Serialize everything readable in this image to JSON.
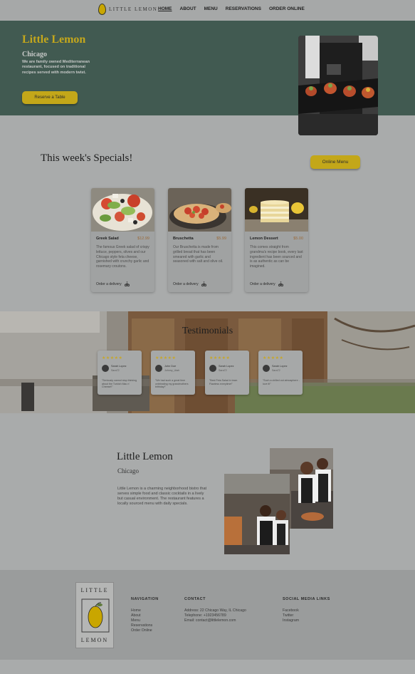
{
  "nav": {
    "logo_text": "LITTLE LEMON",
    "links": [
      "HOME",
      "ABOUT",
      "MENU",
      "RESERVATIONS",
      "ORDER ONLINE"
    ]
  },
  "hero": {
    "title": "Little Lemon",
    "city": "Chicago",
    "description": "We are family owned Mediterranean restaurant, focused on traditional recipes served with modern twist.",
    "button": "Reserve a Table"
  },
  "specials": {
    "title": "This week's Specials!",
    "button": "Online Menu",
    "order_label": "Order a delivery",
    "cards": [
      {
        "name": "Greek Salad",
        "price": "$12.99",
        "description": "The famous Greek salad of crispy lettuce, peppers, olives and our Chicago style feta cheese, garnished with crunchy garlic and rosemary croutons."
      },
      {
        "name": "Bruschetta",
        "price": "$5.99",
        "description": "Our Bruschetta is made from grilled bread that has been smeared with garlic and seasoned with salt and olive oil."
      },
      {
        "name": "Lemon Dessert",
        "price": "$5.00",
        "description": "This comes straight from grandma's recipe book, every last ingredient has been sourced and is as authentic as can be imagined."
      }
    ]
  },
  "testimonials": {
    "title": "Testimonials",
    "stars": "★★★★★",
    "items": [
      {
        "name": "Sarah Lopez",
        "sub": "Sara72",
        "quote": "\"Seriously cannot stop thinking about the Turkish Mac n' Cheese!!\""
      },
      {
        "name": "John Doe",
        "sub": "Johnny_Utah",
        "quote": "\"We had such a great time celebrating my grandmothers bitthday!\""
      },
      {
        "name": "Sarah Lopez",
        "sub": "Sara72",
        "quote": "\"Best Feta Salad in town. Flawless everytime!\""
      },
      {
        "name": "Sarah Lopez",
        "sub": "Sara72",
        "quote": "\"Such a chilled out atmosphere - love it!\""
      }
    ]
  },
  "about": {
    "title": "Little Lemon",
    "city": "Chicago",
    "description": "Little Lemon is a charming neighborhood bistro that serves simple food and classic cocktails in a lively but casual environment. The restaurant features a locally sourced menu with daily specials."
  },
  "footer": {
    "logo_top": "LITTLE",
    "logo_bottom": "LEMON",
    "navigation": {
      "title": "NAVIGATION",
      "items": [
        "Home",
        "About",
        "Menu",
        "Reservations",
        "Order Online"
      ]
    },
    "contact": {
      "title": "CONTACT",
      "items": [
        "Address: 22 Chicago Way, IL Chicago",
        "Telephone: +1923456789",
        "Email: contact@littlelemon.com"
      ]
    },
    "social": {
      "title": "SOCIAL MEDIA LINKS",
      "items": [
        "Facebook",
        "Twitter",
        "Instagram"
      ]
    }
  },
  "colors": {
    "primary_green": "#415a51",
    "primary_yellow": "#c3a719",
    "background": "#a9abab"
  }
}
